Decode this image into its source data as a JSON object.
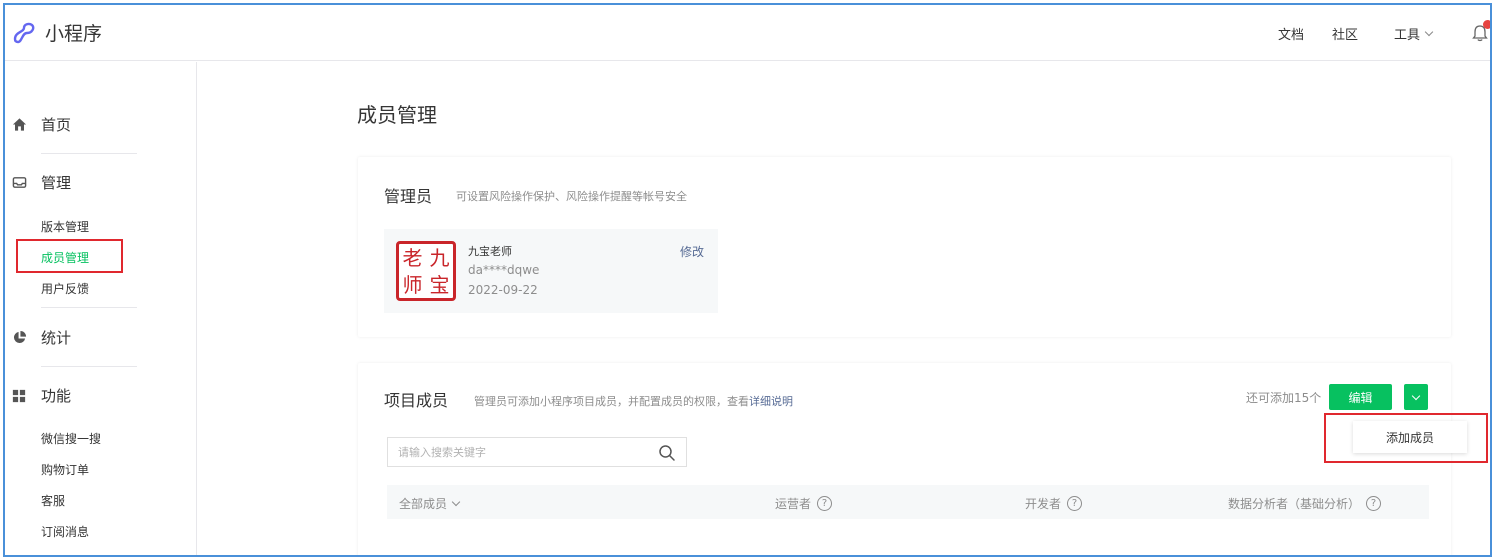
{
  "header": {
    "app_title": "小程序",
    "nav": {
      "docs": "文档",
      "community": "社区",
      "tools": "工具"
    }
  },
  "sidebar": {
    "sections": [
      {
        "label": "首页",
        "icon": "home-icon"
      },
      {
        "label": "管理",
        "icon": "inbox-icon"
      },
      {
        "label": "统计",
        "icon": "pie-chart-icon"
      },
      {
        "label": "功能",
        "icon": "grid-icon"
      }
    ],
    "manage_items": [
      "版本管理",
      "成员管理",
      "用户反馈"
    ],
    "feature_items": [
      "微信搜一搜",
      "购物订单",
      "客服",
      "订阅消息"
    ],
    "active_item": "成员管理"
  },
  "page": {
    "title": "成员管理"
  },
  "admin_card": {
    "title": "管理员",
    "desc": "可设置风险操作保护、风险操作提醒等帐号安全",
    "admin": {
      "seal_chars": [
        "老",
        "九",
        "师",
        "宝"
      ],
      "name": "九宝老师",
      "id": "da****dqwe",
      "date": "2022-09-22",
      "edit_label": "修改"
    }
  },
  "members_card": {
    "title": "项目成员",
    "desc_prefix": "管理员可添加小程序项目成员，并配置成员的权限，查看",
    "desc_link": "详细说明",
    "remaining": "还可添加15个",
    "edit_button": "编辑",
    "dropdown_item": "添加成员",
    "search_placeholder": "请输入搜索关键字",
    "columns": {
      "all": "全部成员",
      "operator": "运营者",
      "developer": "开发者",
      "analyst": "数据分析者（基础分析）"
    }
  },
  "colors": {
    "accent_green": "#07c160",
    "link_blue": "#576b95",
    "highlight_red": "#e0282e",
    "frame_blue": "#4a90d9"
  }
}
